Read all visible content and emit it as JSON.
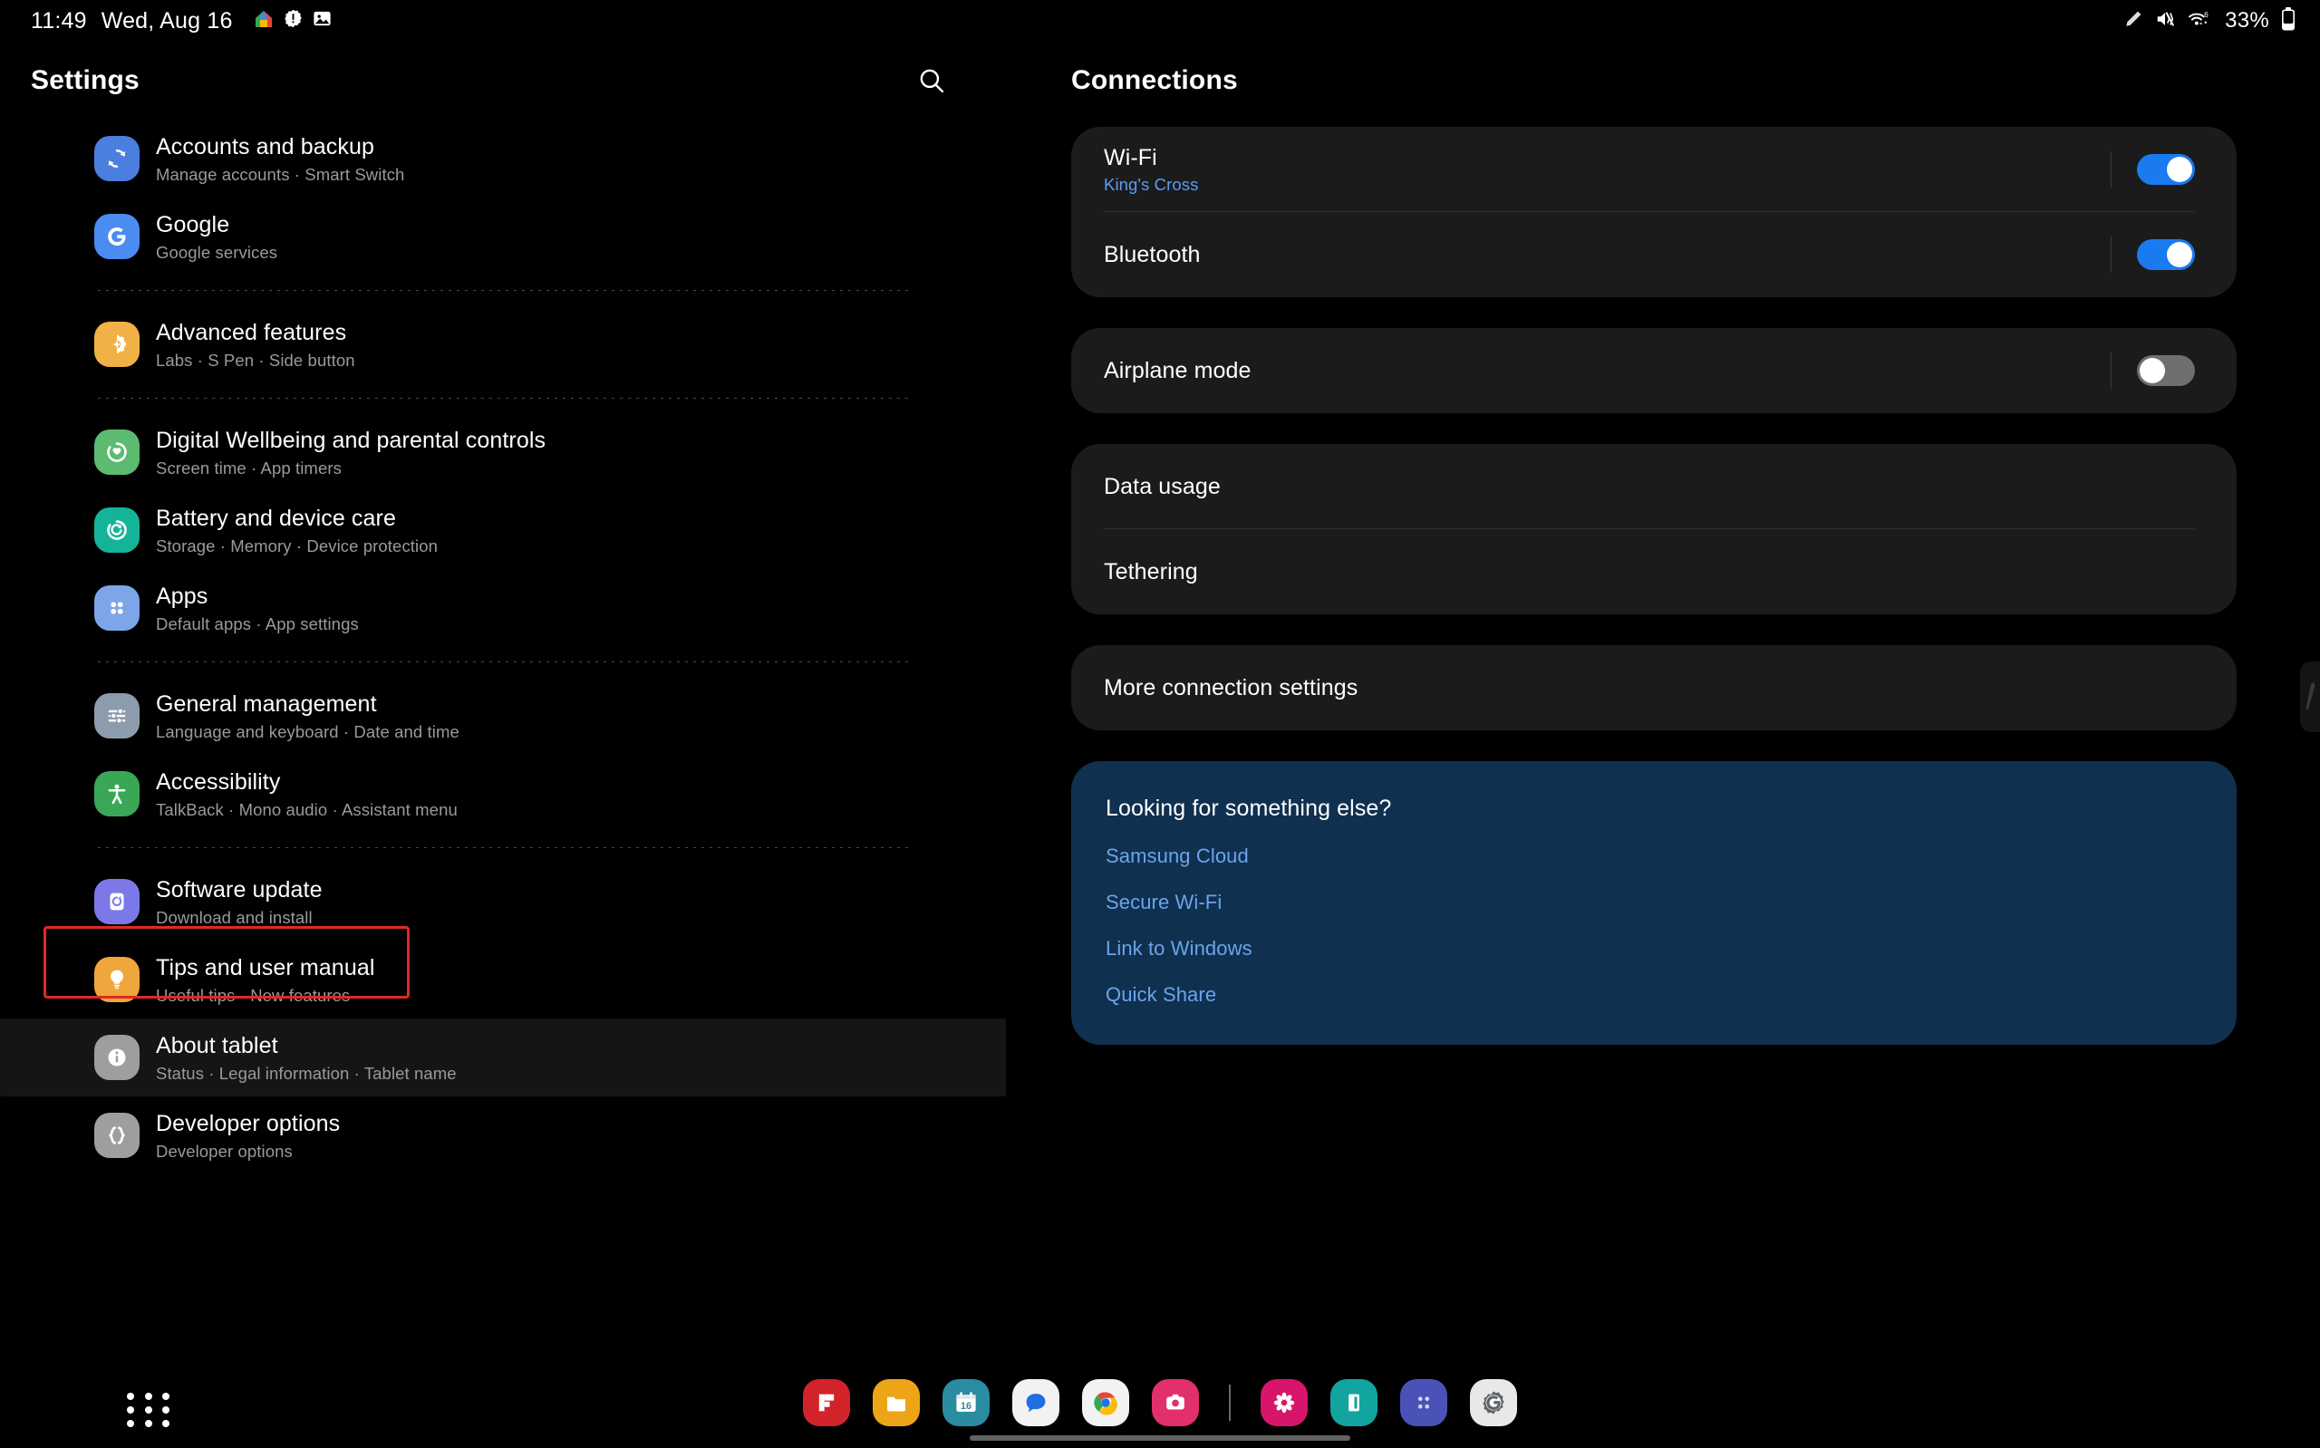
{
  "status_bar": {
    "time": "11:49",
    "date": "Wed, Aug 16",
    "notification_icons": [
      "google-home-icon",
      "alert-badge-icon",
      "image-icon"
    ],
    "right_icons": [
      "s-pen-icon",
      "mute-vibrate-icon",
      "wifi-6-icon"
    ],
    "battery_percent": "33%"
  },
  "left_pane": {
    "title": "Settings",
    "search_icon": "search-icon",
    "items": [
      {
        "title": "Accounts and backup",
        "subtitle": "Manage accounts  ·  Smart Switch",
        "icon": "accounts-backup-icon",
        "color": "#4a7fe0"
      },
      {
        "title": "Google",
        "subtitle": "Google services",
        "icon": "google-icon",
        "color": "#4a8cf0"
      },
      {
        "divider": true
      },
      {
        "title": "Advanced features",
        "subtitle": "Labs  ·  S Pen  ·  Side button",
        "icon": "advanced-features-icon",
        "color": "#f0b246"
      },
      {
        "divider": true
      },
      {
        "title": "Digital Wellbeing and parental controls",
        "subtitle": "Screen time  ·  App timers",
        "icon": "digital-wellbeing-icon",
        "color": "#5cbb70"
      },
      {
        "title": "Battery and device care",
        "subtitle": "Storage  ·  Memory  ·  Device protection",
        "icon": "battery-device-care-icon",
        "color": "#14b498"
      },
      {
        "title": "Apps",
        "subtitle": "Default apps  ·  App settings",
        "icon": "apps-icon",
        "color": "#7da6e8"
      },
      {
        "divider": true
      },
      {
        "title": "General management",
        "subtitle": "Language and keyboard  ·  Date and time",
        "icon": "general-management-icon",
        "color": "#8d9cad"
      },
      {
        "title": "Accessibility",
        "subtitle": "TalkBack  ·  Mono audio  ·  Assistant menu",
        "icon": "accessibility-icon",
        "color": "#3aa757"
      },
      {
        "divider": true
      },
      {
        "title": "Software update",
        "subtitle": "Download and install",
        "icon": "software-update-icon",
        "color": "#7b79e8"
      },
      {
        "title": "Tips and user manual",
        "subtitle": "Useful tips  ·  New features",
        "icon": "tips-manual-icon",
        "color": "#efa63c"
      },
      {
        "title": "About tablet",
        "subtitle": "Status  ·  Legal information  ·  Tablet name",
        "icon": "about-tablet-icon",
        "color": "#9e9e9e",
        "highlighted": true
      },
      {
        "title": "Developer options",
        "subtitle": "Developer options",
        "icon": "developer-options-icon",
        "color": "#9e9e9e"
      }
    ],
    "highlight_color": "#e02a20"
  },
  "right_pane": {
    "title": "Connections",
    "cards": [
      {
        "rows": [
          {
            "label": "Wi-Fi",
            "sublabel": "King's Cross",
            "toggle": "on"
          },
          {
            "label": "Bluetooth",
            "sublabel": "",
            "toggle": "on"
          }
        ]
      },
      {
        "rows": [
          {
            "label": "Airplane mode",
            "sublabel": "",
            "toggle": "off"
          }
        ]
      },
      {
        "rows": [
          {
            "label": "Data usage",
            "sublabel": "",
            "toggle": "none"
          },
          {
            "label": "Tethering",
            "sublabel": "",
            "toggle": "none"
          }
        ]
      },
      {
        "rows": [
          {
            "label": "More connection settings",
            "sublabel": "",
            "toggle": "none"
          }
        ]
      }
    ],
    "promo": {
      "title": "Looking for something else?",
      "links": [
        "Samsung Cloud",
        "Secure Wi-Fi",
        "Link to Windows",
        "Quick Share"
      ],
      "background": "#103050",
      "link_color": "#6ba4ea"
    }
  },
  "taskbar": {
    "app_drawer_icon": "apps-grid-icon",
    "dock_apps": [
      {
        "name": "flipboard-icon",
        "color": "#d3232a",
        "glyph": "F"
      },
      {
        "name": "my-files-icon",
        "color": "#eda517",
        "glyph": ""
      },
      {
        "name": "calendar-icon",
        "color": "#2a8ca0",
        "glyph": "16"
      },
      {
        "name": "messages-icon",
        "color": "#f2f2f2",
        "glyph": ""
      },
      {
        "name": "chrome-icon",
        "color": "#f2f2f2",
        "glyph": ""
      },
      {
        "name": "instagram-icon",
        "color": "#e1306c",
        "glyph": ""
      },
      {
        "name": "dock-separator",
        "color": "",
        "glyph": ""
      },
      {
        "name": "gallery-icon",
        "color": "#d6156b",
        "glyph": ""
      },
      {
        "name": "samsung-notes-icon",
        "color": "#12a5a0",
        "glyph": ""
      },
      {
        "name": "app-group-icon",
        "color": "#4a52b8",
        "glyph": ""
      },
      {
        "name": "google-settings-icon",
        "color": "#e8e8e8",
        "glyph": "G"
      }
    ]
  }
}
